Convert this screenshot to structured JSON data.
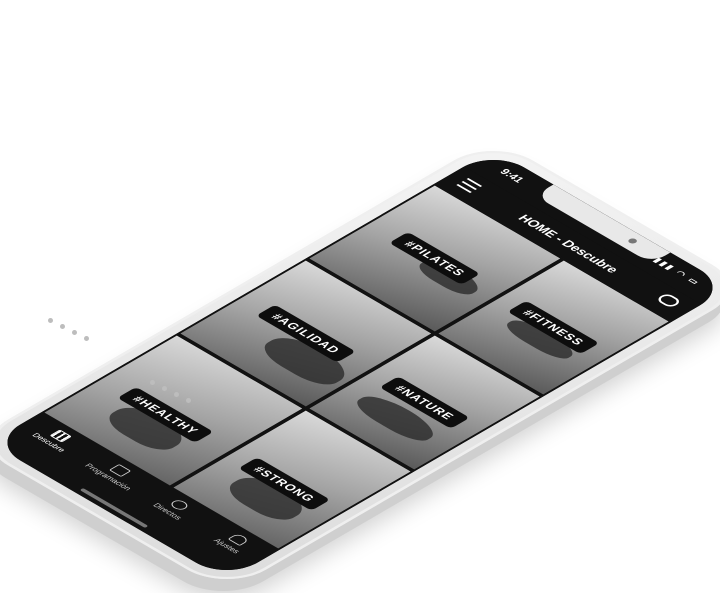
{
  "status": {
    "time": "9:41"
  },
  "appbar": {
    "title": "HOME - Descubre"
  },
  "tiles": [
    {
      "tag": "#PILATES"
    },
    {
      "tag": "#AGILIDAD"
    },
    {
      "tag": "#FITNESS"
    },
    {
      "tag": "#HEALTHY"
    },
    {
      "tag": "#NATURE"
    },
    {
      "tag": "#STRONG"
    }
  ],
  "tabbar": {
    "items": [
      {
        "label": "Descubre",
        "icon": "grid-icon"
      },
      {
        "label": "Programación",
        "icon": "calendar-icon"
      },
      {
        "label": "Directos",
        "icon": "broadcast-icon"
      },
      {
        "label": "Ajustes",
        "icon": "user-icon"
      }
    ]
  }
}
